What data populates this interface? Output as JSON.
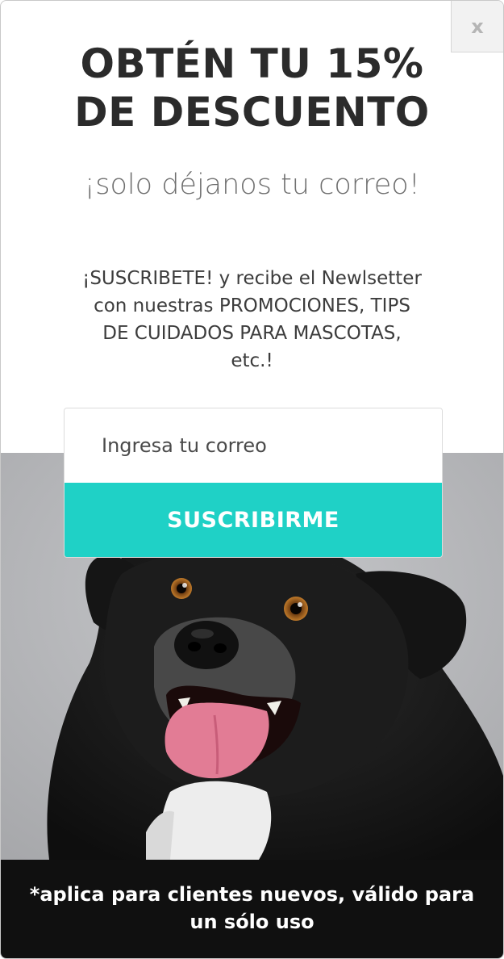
{
  "popup": {
    "close_label": "x",
    "headline_line1": "OBTÉN TU 15%",
    "headline_line2": "DE DESCUENTO",
    "subtitle": "¡solo déjanos tu correo!",
    "body_line1": "¡SUSCRIBETE! y recibe el Newlsetter",
    "body_line2": "con nuestras PROMOCIONES, TIPS",
    "body_line3": "DE CUIDADOS PARA MASCOTAS,",
    "body_line4": "etc.!",
    "email_placeholder": "Ingresa tu correo",
    "submit_label": "SUSCRIBIRME",
    "footer_line1": "*aplica para clientes nuevos, válido para",
    "footer_line2": "un sólo uso",
    "image_subject": "dog-photo",
    "accent_color": "#1fd1c6",
    "footer_color": "#101010"
  }
}
